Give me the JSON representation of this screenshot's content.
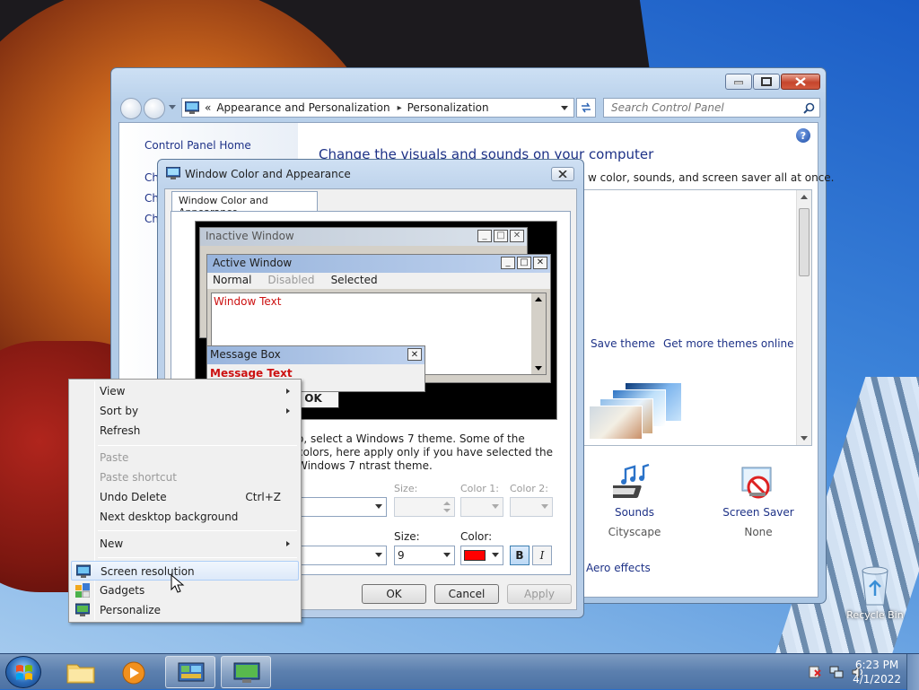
{
  "control_panel": {
    "breadcrumb": {
      "prefix": "«",
      "parent": "Appearance and Personalization",
      "arrow": "▸",
      "current": "Personalization"
    },
    "search_placeholder": "Search Control Panel",
    "left_nav": {
      "home": "Control Panel Home",
      "items": [
        "Ch",
        "Ch",
        "Ch"
      ]
    },
    "heading": "Change the visuals and sounds on your computer",
    "subheading": "w color, sounds, and screen saver all at once.",
    "theme_links": {
      "save": "Save theme",
      "online": "Get more themes online"
    },
    "bottom": [
      {
        "name": "Sounds",
        "value": "Cityscape"
      },
      {
        "name": "Screen Saver",
        "value": "None"
      }
    ],
    "aero_link": "Aero effects"
  },
  "dialog": {
    "title": "Window Color and Appearance",
    "tab": "Window Color and Appearance",
    "preview": {
      "inactive_title": "Inactive Window",
      "active_title": "Active Window",
      "menu": {
        "normal": "Normal",
        "disabled": "Disabled",
        "selected": "Selected"
      },
      "window_text": "Window Text",
      "msgbox_title": "Message Box",
      "msgbox_text": "Message Text",
      "ok": "OK"
    },
    "description": "o, select a Windows 7 theme.  Some of the colors, here apply only if you have selected the Windows 7 ntrast theme.",
    "row1": {
      "size_label": "Size:",
      "color1_label": "Color 1:",
      "color2_label": "Color 2:"
    },
    "row2": {
      "size_label": "Size:",
      "size_value": "9",
      "color_label": "Color:",
      "bold": "B",
      "italic": "I"
    },
    "buttons": {
      "ok": "OK",
      "cancel": "Cancel",
      "apply": "Apply"
    },
    "font_color": "#ff0000"
  },
  "context_menu": {
    "items": [
      {
        "label": "View",
        "submenu": true
      },
      {
        "label": "Sort by",
        "submenu": true
      },
      {
        "label": "Refresh"
      },
      {
        "label": "Paste",
        "disabled": true
      },
      {
        "label": "Paste shortcut",
        "disabled": true
      },
      {
        "label": "Undo Delete",
        "shortcut": "Ctrl+Z"
      },
      {
        "label": "Next desktop background"
      },
      {
        "label": "New",
        "submenu": true
      },
      {
        "label": "Screen resolution",
        "icon": "display-icon"
      },
      {
        "label": "Gadgets",
        "icon": "gadgets-icon"
      },
      {
        "label": "Personalize",
        "icon": "personalize-icon"
      }
    ]
  },
  "desktop": {
    "recycle_bin": "Recycle Bin"
  },
  "taskbar": {
    "time": "6:23 PM",
    "date": "4/1/2022"
  }
}
